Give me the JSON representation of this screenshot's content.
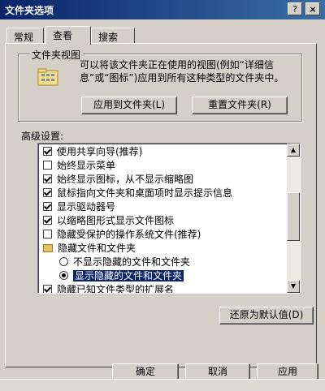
{
  "window": {
    "title": "文件夹选项",
    "help_label": "?",
    "close_label": "×"
  },
  "tabs": [
    {
      "label": "常规"
    },
    {
      "label": "查看"
    },
    {
      "label": "搜索"
    }
  ],
  "folder_views": {
    "legend": "文件夹视图",
    "description": "可以将该文件夹正在使用的视图(例如“详细信息”或“图标”)应用到所有这种类型的文件夹中。",
    "apply_button": "应用到文件夹(L)",
    "reset_button": "重置文件夹(R)"
  },
  "advanced": {
    "label": "高级设置:",
    "items": [
      {
        "type": "checkbox",
        "checked": true,
        "label": "使用共享向导(推荐)"
      },
      {
        "type": "checkbox",
        "checked": false,
        "label": "始终显示菜单"
      },
      {
        "type": "checkbox",
        "checked": true,
        "label": "始终显示图标，从不显示缩略图"
      },
      {
        "type": "checkbox",
        "checked": true,
        "label": "鼠标指向文件夹和桌面项时显示提示信息"
      },
      {
        "type": "checkbox",
        "checked": true,
        "label": "显示驱动器号"
      },
      {
        "type": "checkbox",
        "checked": true,
        "label": "以缩略图形式显示文件图标"
      },
      {
        "type": "checkbox",
        "checked": false,
        "label": "隐藏受保护的操作系统文件(推荐)"
      },
      {
        "type": "folder",
        "label": "隐藏文件和文件夹"
      },
      {
        "type": "radio",
        "checked": false,
        "label": "不显示隐藏的文件和文件夹"
      },
      {
        "type": "radio",
        "checked": true,
        "label": "显示隐藏的文件和文件夹",
        "selected": true
      },
      {
        "type": "checkbox",
        "checked": true,
        "label": "隐藏已知文件类型的扩展名"
      }
    ],
    "restore_button": "还原为默认值(D)"
  },
  "footer": {
    "ok": "确定",
    "cancel": "取消",
    "apply": "应用"
  }
}
